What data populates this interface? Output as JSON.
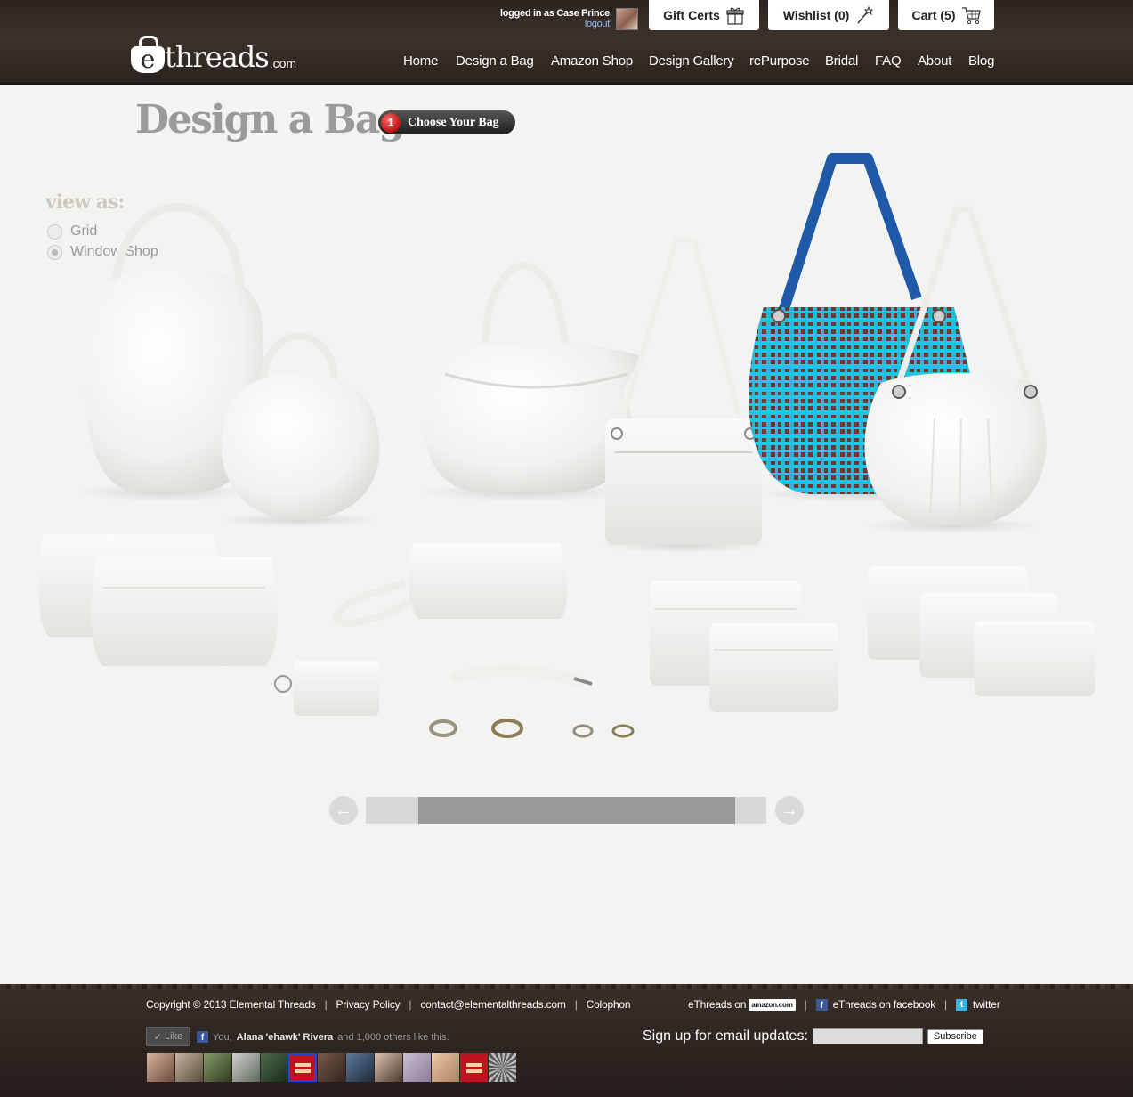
{
  "header": {
    "login_text": "logged in as Case Prince",
    "logout_label": "logout",
    "gift_certs": "Gift Certs",
    "wishlist": "Wishlist (0)",
    "cart": "Cart (5)",
    "logo_e": "e",
    "logo_word": "threads",
    "logo_suffix": ".com",
    "nav": [
      "Home",
      "Design a Bag",
      "Amazon Shop",
      "Design Gallery",
      "rePurpose",
      "Bridal",
      "FAQ",
      "About",
      "Blog"
    ]
  },
  "main": {
    "title": "Design a Bag",
    "step_number": "1",
    "step_label": "Choose Your Bag",
    "view_as_label": "view as:",
    "view_options": [
      {
        "label": "Grid",
        "selected": false
      },
      {
        "label": "Window Shop",
        "selected": true
      }
    ],
    "scroll_position": 0.13,
    "scroll_visible": 0.79
  },
  "footer": {
    "copyright": "Copyright © 2013 Elemental Threads",
    "privacy": "Privacy Policy",
    "contact": "contact@elementalthreads.com",
    "colophon": "Colophon",
    "amazon_text": "eThreads on",
    "amazon_badge": "amazon.com",
    "facebook_text": "eThreads on facebook",
    "twitter_text": "twitter",
    "like_label": "Like",
    "like_prefix": "You,",
    "like_name": "Alana 'ehawk' Rivera",
    "like_suffix": "and 1,000 others like this.",
    "signup_label": "Sign up for email updates:",
    "subscribe_label": "Subscribe"
  },
  "colors": {
    "header_bg": "#3c322b",
    "title_gray": "#9d9a9b",
    "accent_blue": "#1f5aa8",
    "accent_cyan": "#1ec6e8",
    "accent_brown": "#6a3a2c",
    "step_red": "#c01313"
  }
}
